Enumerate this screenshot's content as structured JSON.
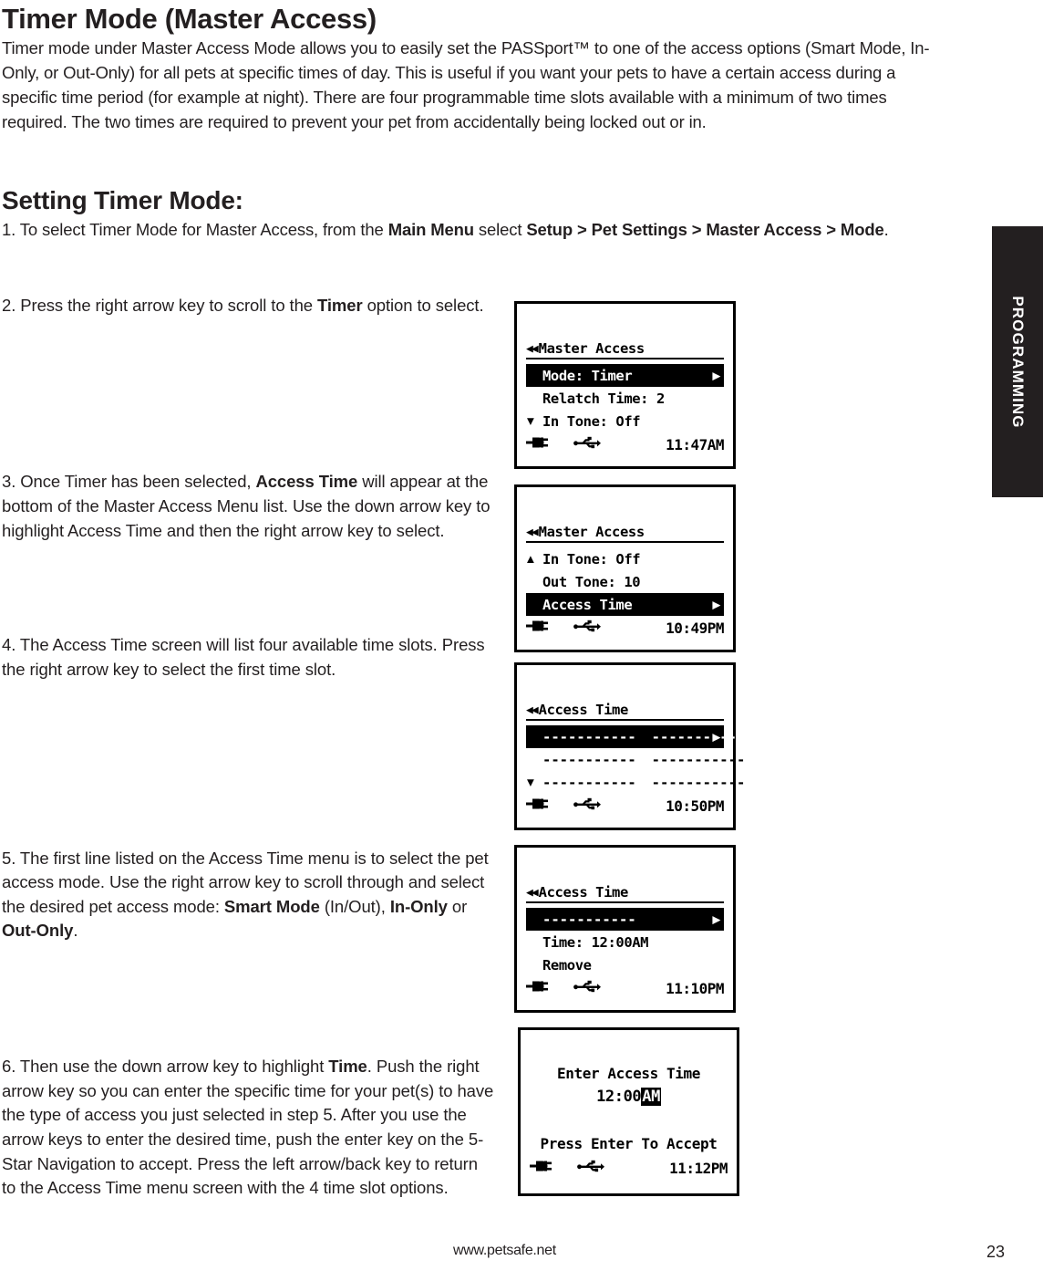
{
  "page": {
    "title": "Timer Mode (Master Access)",
    "intro": "Timer mode under Master Access Mode allows you to easily set the PASSport™ to one of the access options (Smart Mode, In-Only, or Out-Only) for all pets at specific times of day. This is useful if you want your pets to have a certain access during a specific time period (for example at night). There are four programmable time slots available with a minimum of two times required. The two times are required to prevent your pet from accidentally being locked out or in.",
    "section_heading": "Setting Timer Mode:"
  },
  "side_tab": {
    "label": "PROGRAMMING",
    "background": "#231f20",
    "text_color": "#ffffff"
  },
  "steps": {
    "step1_html": "1.  To select Timer Mode for Master Access, from the <b>Main Menu</b> select <b>Setup &gt; Pet Settings &gt; Master Access &gt; Mode</b>.",
    "step2_html": "2.  Press the right arrow key to scroll to the <b>Timer</b> option to select.",
    "step3_html": "3.  Once Timer has been selected, <b>Access Time</b> will appear at the bottom of the Master Access Menu list. Use the down arrow key to highlight Access Time and then the right arrow key to select.",
    "step4_html": "4.  The Access Time screen will list four available time slots. Press the right arrow key to select the first time slot.",
    "step5_html": "5.  The first line listed on the Access Time menu is to select the pet access mode. Use the right arrow key to scroll through and select the desired pet access mode: <b>Smart Mode</b> (In/Out), <b>In-Only</b> or <b>Out-Only</b>.",
    "step6_html": "6.  Then use the down arrow key to highlight <b>Time</b>. Push the right arrow key so you can enter the specific time for your pet(s) to have the type of access you just selected in step 5. After you use the arrow keys to enter the desired time, push the enter key on the 5-Star Navigation to accept. Press the left arrow/back key to return to the Access Time menu screen with the 4 time slot options."
  },
  "screens": [
    {
      "id": "screen-master-access-mode-timer",
      "back_icon": "double-left-arrow-icon",
      "title": "Master Access",
      "rows": [
        {
          "caret": "",
          "label": "Mode: Timer",
          "selected": true,
          "right_arrow": true
        },
        {
          "caret": "",
          "label": "Relatch Time: 2",
          "selected": false,
          "right_arrow": false
        },
        {
          "caret": "▼",
          "label": "In Tone: Off",
          "selected": false,
          "right_arrow": false
        }
      ],
      "status": {
        "plug_icon": "power-plug-icon",
        "usb_icon": "usb-icon",
        "time": "11:47AM"
      }
    },
    {
      "id": "screen-master-access-access-time",
      "back_icon": "double-left-arrow-icon",
      "title": "Master Access",
      "rows": [
        {
          "caret": "▲",
          "label": "In Tone: Off",
          "selected": false,
          "right_arrow": false
        },
        {
          "caret": "",
          "label": "Out Tone: 10",
          "selected": false,
          "right_arrow": false
        },
        {
          "caret": "",
          "label": "Access Time",
          "selected": true,
          "right_arrow": true
        }
      ],
      "status": {
        "plug_icon": "power-plug-icon",
        "usb_icon": "usb-icon",
        "time": "10:49PM"
      }
    },
    {
      "id": "screen-access-time-slots",
      "back_icon": "double-left-arrow-icon",
      "title": "Access Time",
      "dash_rows": [
        {
          "caret": "",
          "left": "-----------",
          "right": "-----------",
          "selected": true,
          "right_arrow": true
        },
        {
          "caret": "",
          "left": "-----------",
          "right": "-----------",
          "selected": false,
          "right_arrow": false
        },
        {
          "caret": "▼",
          "left": "-----------",
          "right": "-----------",
          "selected": false,
          "right_arrow": false
        }
      ],
      "status": {
        "plug_icon": "power-plug-icon",
        "usb_icon": "usb-icon",
        "time": "10:50PM"
      }
    },
    {
      "id": "screen-access-time-slot-detail",
      "back_icon": "double-left-arrow-icon",
      "title": "Access Time",
      "rows": [
        {
          "caret": "",
          "label": "-----------",
          "selected": true,
          "right_arrow": true,
          "mono": true
        },
        {
          "caret": "",
          "label": "Time:  12:00AM",
          "selected": false,
          "right_arrow": false
        },
        {
          "caret": "",
          "label": "Remove",
          "selected": false,
          "right_arrow": false
        }
      ],
      "status": {
        "plug_icon": "power-plug-icon",
        "usb_icon": "usb-icon",
        "time": "11:10PM"
      }
    },
    {
      "id": "screen-enter-access-time",
      "heading": "Enter Access Time",
      "time_prefix": "12:00",
      "time_meridiem": "AM",
      "prompt": "Press Enter To Accept",
      "status": {
        "plug_icon": "power-plug-icon",
        "usb_icon": "usb-icon",
        "time": "11:12PM"
      }
    }
  ],
  "footer": {
    "url": "www.petsafe.net",
    "page_number": "23"
  }
}
